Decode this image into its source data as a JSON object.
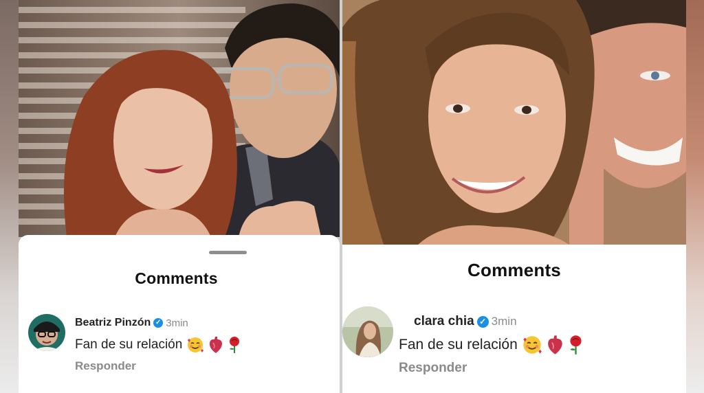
{
  "colors": {
    "verified_blue": "#1a8fe3",
    "meta_gray": "#8a8a8a",
    "sheet_white": "#ffffff"
  },
  "left_post": {
    "sheet_title": "Comments",
    "comment": {
      "username": "Beatriz Pinzón",
      "verified_icon": "verified-badge-icon",
      "time": "3min",
      "text": "Fan de su relación",
      "emojis": [
        "smiling-face-with-hearts",
        "anatomical-heart",
        "rose"
      ],
      "reply_label": "Responder"
    }
  },
  "right_post": {
    "sheet_title": "Comments",
    "comment": {
      "username": "clara chia",
      "verified_icon": "verified-badge-icon",
      "time": "3min",
      "text": "Fan de su relación",
      "emojis": [
        "smiling-face-with-hearts",
        "anatomical-heart",
        "rose"
      ],
      "reply_label": "Responder"
    }
  }
}
